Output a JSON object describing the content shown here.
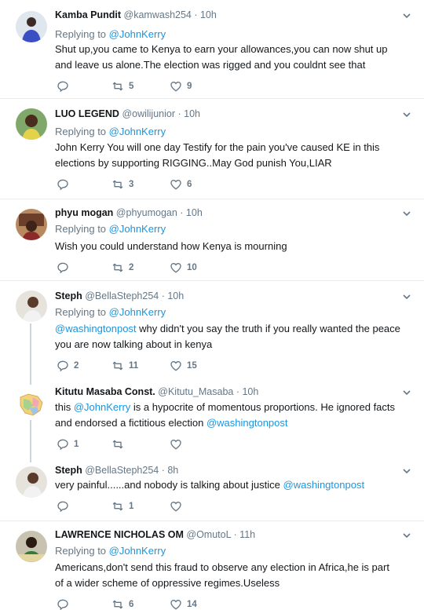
{
  "replying_prefix": "Replying to",
  "tweets": [
    {
      "name": "Kamba Pundit",
      "handle": "@kamwash254 · 10h",
      "replying_to": "@JohnKerry",
      "text": "Shut up,you came to Kenya to earn your allowances,you can now shut up and leave us alone.The election was rigged and you couldnt see that",
      "replies": "",
      "retweets": "5",
      "likes": "9"
    },
    {
      "name": "LUO LEGEND",
      "handle": "@owilijunior · 10h",
      "replying_to": "@JohnKerry",
      "text": "John Kerry You will one day Testify for the pain you've caused KE in this elections by supporting RIGGING..May God punish You,LIAR",
      "replies": "",
      "retweets": "3",
      "likes": "6"
    },
    {
      "name": "phyu mogan",
      "handle": "@phyumogan · 10h",
      "replying_to": "@JohnKerry",
      "text": "Wish you could understand how Kenya is mourning",
      "replies": "",
      "retweets": "2",
      "likes": "10"
    },
    {
      "name": "Steph",
      "handle": "@BellaSteph254 · 10h",
      "replying_to": "@JohnKerry",
      "text_link": "@washingtonpost",
      "text": " why didn't you say the truth if you really wanted the peace you are now talking about in kenya",
      "replies": "2",
      "retweets": "11",
      "likes": "15"
    },
    {
      "name": "Kitutu Masaba Const.",
      "handle": "@Kitutu_Masaba · 10h",
      "text_a": "this ",
      "text_link1": "@JohnKerry",
      "text_b": " is a hypocrite of momentous proportions. He ignored facts and endorsed a fictitious election ",
      "text_link2": "@washingtonpost",
      "replies": "1",
      "retweets": "",
      "likes": ""
    },
    {
      "name": "Steph",
      "handle": "@BellaSteph254 · 8h",
      "text_a": "very painful......and nobody is talking about justice ",
      "text_link": "@washingtonpost",
      "replies": "",
      "retweets": "1",
      "likes": ""
    },
    {
      "name": "LAWRENCE NICHOLAS OM",
      "handle": "@OmutoL · 11h",
      "replying_to": "@JohnKerry",
      "text": "Americans,don't send this fraud to observe any election in Africa,he is part of a wider scheme of oppressive regimes.Useless",
      "replies": "",
      "retweets": "6",
      "likes": "14"
    }
  ]
}
